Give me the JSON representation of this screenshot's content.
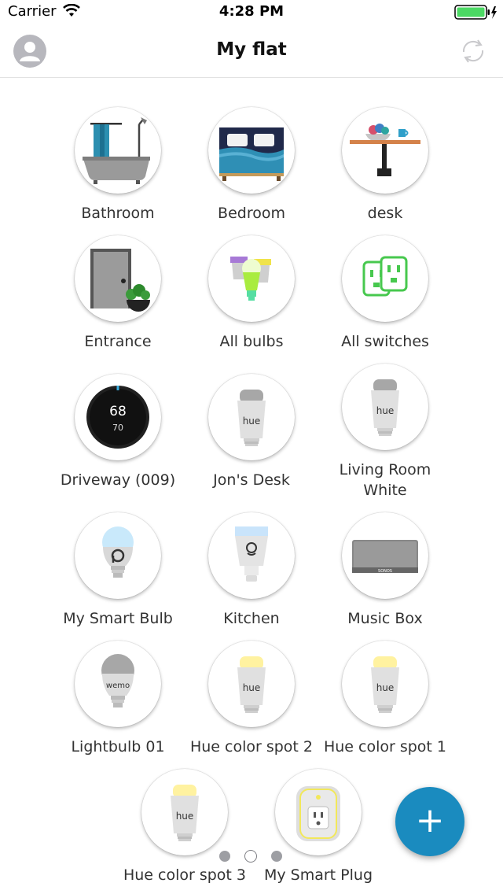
{
  "status_bar": {
    "carrier": "Carrier",
    "time": "4:28 PM"
  },
  "header": {
    "title": "My flat"
  },
  "thermostat": {
    "temp": "68",
    "setpoint": "70"
  },
  "hue_text": "hue",
  "wemo_text": "wemo",
  "sonos_text": "SONOS",
  "tiles": [
    {
      "label": "Bathroom",
      "icon": "bathtub-icon"
    },
    {
      "label": "Bedroom",
      "icon": "bed-icon"
    },
    {
      "label": "desk",
      "icon": "desk-icon"
    },
    {
      "label": "Entrance",
      "icon": "door-icon"
    },
    {
      "label": "All bulbs",
      "icon": "bulbs-icon"
    },
    {
      "label": "All switches",
      "icon": "switches-icon"
    },
    {
      "label": "Driveway (009)",
      "icon": "thermostat-icon"
    },
    {
      "label": "Jon's Desk",
      "icon": "hue-bulb-icon"
    },
    {
      "label": "Living Room White",
      "icon": "hue-bulb-icon"
    },
    {
      "label": "My Smart Bulb",
      "icon": "smart-bulb-icon"
    },
    {
      "label": "Kitchen",
      "icon": "led-bulb-icon"
    },
    {
      "label": "Music Box",
      "icon": "speaker-icon"
    },
    {
      "label": "Lightbulb 01",
      "icon": "wemo-bulb-icon"
    },
    {
      "label": "Hue color spot 2",
      "icon": "hue-bulb-yellow-icon"
    },
    {
      "label": "Hue color spot 1",
      "icon": "hue-bulb-yellow-icon"
    },
    {
      "label": "Hue color spot 3",
      "icon": "hue-bulb-yellow-icon"
    },
    {
      "label": "My Smart Plug",
      "icon": "smart-plug-icon"
    }
  ],
  "page_indicator": {
    "current": 2,
    "total": 3
  },
  "fab": {
    "label": "+",
    "color": "#1a8bbf"
  },
  "colors": {
    "battery": "#4cd964",
    "fab": "#1a8bbf",
    "hue_yellow": "#fff2a0",
    "hue_gray": "#a7a7a7"
  }
}
